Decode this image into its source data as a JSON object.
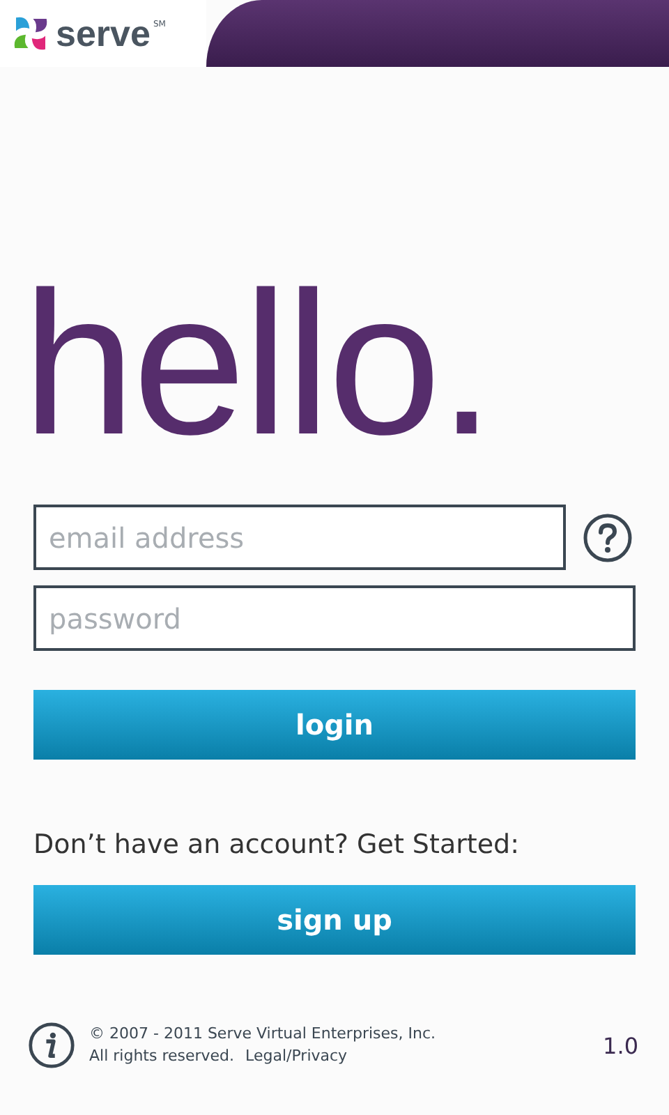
{
  "header": {
    "brand": "serve",
    "brand_mark": "SM"
  },
  "greeting": "hello.",
  "form": {
    "email": {
      "placeholder": "email address"
    },
    "password": {
      "placeholder": "password"
    },
    "login_button": "login"
  },
  "signup": {
    "prompt": "Don’t have an account? Get Started:",
    "button": "sign up"
  },
  "footer": {
    "copyright": "© 2007 - 2011 Serve Virtual Enterprises, Inc.",
    "rights": "All rights reserved.",
    "link": "Legal/Privacy",
    "version": "1.0"
  }
}
